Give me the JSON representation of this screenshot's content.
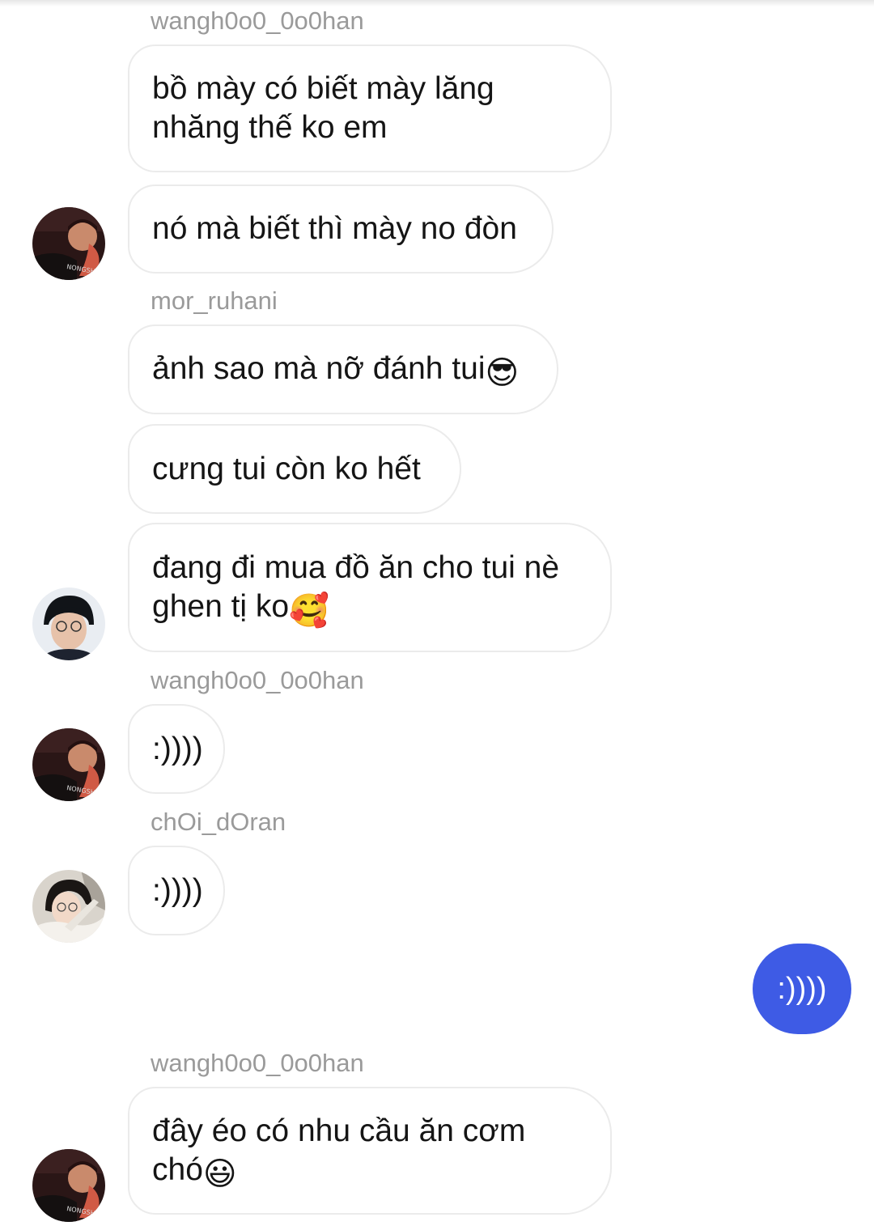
{
  "messages": [
    {
      "username": "wangh0o0_0o0han"
    },
    {
      "text": "bồ mày có biết mày lăng\nnhăng thế ko em"
    },
    {
      "text": "nó mà biết thì mày no đòn"
    },
    {
      "username": "mor_ruhani"
    },
    {
      "text": "ảnh sao mà nỡ đánh tui",
      "emoji": "😎",
      "emoji_name": "sunglasses-emoji"
    },
    {
      "text": "cưng tui còn ko hết"
    },
    {
      "text": "đang đi mua đồ ăn cho tui nè\nghen tị ko",
      "emoji": "🥰",
      "emoji_name": "smiling-face-with-hearts-emoji"
    },
    {
      "username": "wangh0o0_0o0han"
    },
    {
      "text": ":))))"
    },
    {
      "username": "chOi_dOran"
    },
    {
      "text": ":))))"
    },
    {
      "sent_text": ":))))"
    },
    {
      "username": "wangh0o0_0o0han"
    },
    {
      "text": "đây éo có nhu cầu ăn cơm\nchó",
      "emoji": "😃",
      "emoji_name": "grinning-face-emoji"
    }
  ],
  "avatars": [
    {
      "name": "avatar-wangh0o0",
      "label": "NONGSH"
    },
    {
      "name": "avatar-mor-ruhani"
    },
    {
      "name": "avatar-wangh0o0",
      "label": "NONGSH"
    },
    {
      "name": "avatar-choi-doran"
    },
    {
      "name": "avatar-wangh0o0",
      "label": "NONGSH"
    }
  ],
  "colors": {
    "sent_bubble": "#3e5be5",
    "username_text": "#9a9a9a",
    "bubble_border": "#ebebeb"
  }
}
